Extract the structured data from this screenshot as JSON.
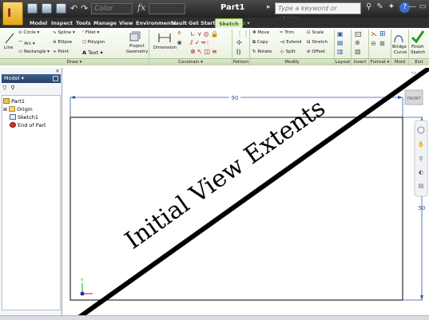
{
  "title_bar": {
    "color_combo": "Color",
    "fx_label": "fx",
    "document_title": "Part1",
    "search_placeholder": "Type a keyword or phrase"
  },
  "tabs": [
    {
      "label": "Model",
      "active": false
    },
    {
      "label": "Inspect",
      "active": false
    },
    {
      "label": "Tools",
      "active": false
    },
    {
      "label": "Manage",
      "active": false
    },
    {
      "label": "View",
      "active": false
    },
    {
      "label": "Environments",
      "active": false
    },
    {
      "label": "Vault",
      "active": false
    },
    {
      "label": "Get Started",
      "active": false
    },
    {
      "label": "Sketch",
      "active": true
    }
  ],
  "ribbon": {
    "draw": {
      "line": "Line",
      "circle": "Circle",
      "arc": "Arc",
      "rectangle": "Rectangle",
      "spline": "Spline",
      "ellipse": "Ellipse",
      "point": "Point",
      "fillet": "Fillet",
      "polygon": "Polygon",
      "text": "Text",
      "project_geometry_1": "Project",
      "project_geometry_2": "Geometry",
      "panel_label": "Draw"
    },
    "constrain": {
      "dimension": "Dimension",
      "panel_label": "Constrain"
    },
    "pattern": {
      "panel_label": "Pattern"
    },
    "modify": {
      "move": "Move",
      "copy": "Copy",
      "rotate": "Rotate",
      "trim": "Trim",
      "extend": "Extend",
      "split": "Split",
      "scale": "Scale",
      "stretch": "Stretch",
      "offset": "Offset",
      "panel_label": "Modify"
    },
    "layout": {
      "panel_label": "Layout"
    },
    "insert": {
      "panel_label": "Insert"
    },
    "format": {
      "panel_label": "Format"
    },
    "mold": {
      "bridge_1": "Bridge",
      "bridge_2": "Curve",
      "panel_label": "Mold"
    },
    "exit": {
      "finish_1": "Finish",
      "finish_2": "Sketch",
      "panel_label": "Exit"
    }
  },
  "browser": {
    "header": "Model",
    "tree": [
      {
        "label": "Part1",
        "icon": "part-icon"
      },
      {
        "label": "Origin",
        "icon": "folder-icon"
      },
      {
        "label": "Sketch1",
        "icon": "sketch-icon"
      },
      {
        "label": "End of Part",
        "icon": "end-of-part-icon"
      }
    ]
  },
  "canvas": {
    "horizontal_dimension": "90",
    "vertical_dimension": "50",
    "viewcube_face": "FRONT",
    "overlay_text": "Initial View Extents",
    "colors": {
      "dimension": "#2c5aa0",
      "overlay": "#000000",
      "origin_y": "#1aa01a",
      "origin_x": "#d01010"
    }
  },
  "status": {
    "text": "..."
  }
}
